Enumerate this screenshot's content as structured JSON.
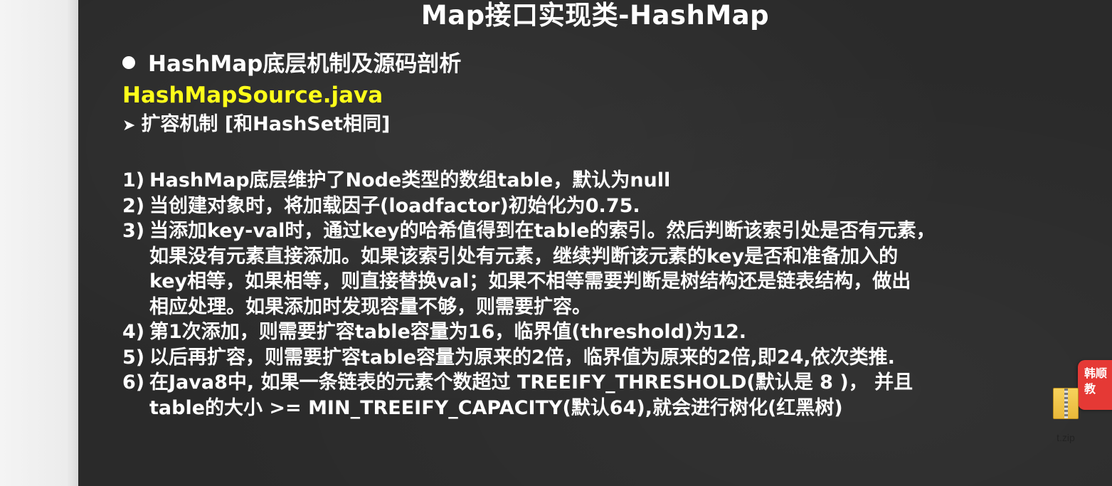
{
  "slide": {
    "title": "Map接口实现类-HashMap",
    "heading": "HashMap底层机制及源码剖析",
    "filename": "HashMapSource.java",
    "subheading": "扩容机制 [和HashSet相同]",
    "points": [
      {
        "num": "1)",
        "lines": [
          "HashMap底层维护了Node类型的数组table，默认为null"
        ]
      },
      {
        "num": "2)",
        "lines": [
          "当创建对象时，将加载因子(loadfactor)初始化为0.75."
        ]
      },
      {
        "num": "3)",
        "lines": [
          "当添加key-val时，通过key的哈希值得到在table的索引。然后判断该索引处是否有元素，",
          "如果没有元素直接添加。如果该索引处有元素，继续判断该元素的key是否和准备加入的",
          "key相等，如果相等，则直接替换val；如果不相等需要判断是树结构还是链表结构，做出",
          "相应处理。如果添加时发现容量不够，则需要扩容。"
        ]
      },
      {
        "num": "4)",
        "lines": [
          "第1次添加，则需要扩容table容量为16，临界值(threshold)为12."
        ]
      },
      {
        "num": "5)",
        "lines": [
          "以后再扩容，则需要扩容table容量为原来的2倍，临界值为原来的2倍,即24,依次类推."
        ]
      },
      {
        "num": "6)",
        "lines": [
          "在Java8中, 如果一条链表的元素个数超过 TREEIFY_THRESHOLD(默认是 8 )， 并且",
          "table的大小 >= MIN_TREEIFY_CAPACITY(默认64),就会进行树化(红黑树)"
        ]
      }
    ]
  },
  "side_badge": {
    "line1": "韩顺",
    "line2": "教"
  },
  "desktop_file": {
    "label": "t.zip",
    "icon": "zip-archive-icon"
  },
  "colors": {
    "slide_background": "#2a2a2a",
    "filename_highlight": "#ffff1a",
    "badge": "#e53935"
  }
}
